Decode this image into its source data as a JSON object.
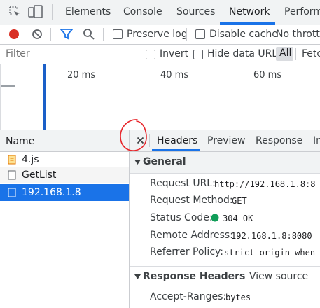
{
  "toolbar": {
    "tabs": [
      {
        "label": "Elements"
      },
      {
        "label": "Console"
      },
      {
        "label": "Sources"
      },
      {
        "label": "Network"
      },
      {
        "label": "Performa"
      }
    ]
  },
  "network_toolbar": {
    "preserve_log": "Preserve log",
    "disable_cache": "Disable cache",
    "throttling": "No throttlir"
  },
  "filter_bar": {
    "placeholder": "Filter",
    "invert": "Invert",
    "hide_data_urls": "Hide data URLs",
    "all": "All",
    "fetch": "Fetc"
  },
  "timeline": {
    "ticks": [
      "20 ms",
      "40 ms",
      "60 ms"
    ]
  },
  "requests": {
    "header": "Name",
    "items": [
      {
        "name": "4.js"
      },
      {
        "name": "GetList"
      },
      {
        "name": "192.168.1.8"
      }
    ]
  },
  "details": {
    "tabs": [
      {
        "label": "Headers"
      },
      {
        "label": "Preview"
      },
      {
        "label": "Response"
      },
      {
        "label": "In"
      }
    ],
    "general": {
      "title": "General",
      "rows": [
        {
          "key": "Request URL:",
          "value": "http://192.168.1.8:8"
        },
        {
          "key": "Request Method:",
          "value": "GET"
        },
        {
          "key": "Status Code:",
          "value": "304 OK"
        },
        {
          "key": "Remote Address:",
          "value": "192.168.1.8:8080"
        },
        {
          "key": "Referrer Policy:",
          "value": "strict-origin-when"
        }
      ]
    },
    "response_headers": {
      "title": "Response Headers",
      "view_source": "View source",
      "rows": [
        {
          "key": "Accept-Ranges:",
          "value": "bytes"
        }
      ]
    }
  },
  "colors": {
    "accent": "#1a73e8",
    "selected_row": "#1a73e8",
    "record": "#d93025",
    "status_ok": "#0f9d58",
    "annotation": "#e8262b"
  }
}
